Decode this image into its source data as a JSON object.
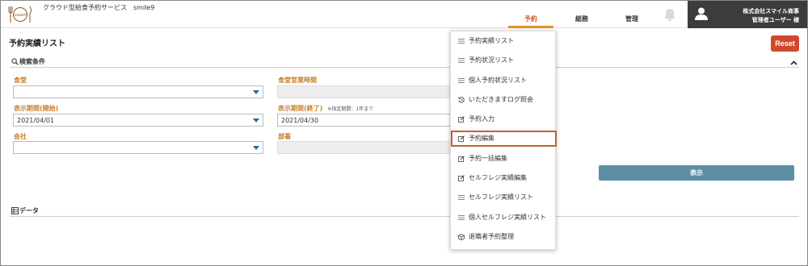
{
  "app": {
    "title": "クラウド型給食予約サービス　smile9",
    "logo_text": "Smile9"
  },
  "nav": {
    "tabs": [
      {
        "label": "予約"
      },
      {
        "label": "総務"
      },
      {
        "label": "管理"
      }
    ]
  },
  "user": {
    "company": "株式会社スマイル商事",
    "name": "管理者ユーザー 様"
  },
  "page": {
    "title": "予約実績リスト",
    "reset_label": "Reset",
    "search_section": "検索条件",
    "data_section": "データ",
    "show_label": "表示"
  },
  "form": {
    "cafeteria_label": "食堂",
    "cafeteria_value": "",
    "hours_label": "食堂営業時間",
    "start_label": "表示期間(開始)",
    "start_value": "2021/04/01",
    "end_label": "表示期間(終了)",
    "end_note": "※指定期間：1年まで",
    "end_value": "2021/04/30",
    "company_label": "会社",
    "company_value": "",
    "dept_label": "部署"
  },
  "menu": {
    "items": [
      {
        "label": "予約実績リスト",
        "icon": "list-icon"
      },
      {
        "label": "予約状況リスト",
        "icon": "list-icon"
      },
      {
        "label": "個人予約状況リスト",
        "icon": "list-icon"
      },
      {
        "label": "いただきますログ照会",
        "icon": "history-icon"
      },
      {
        "label": "予約入力",
        "icon": "edit-icon"
      },
      {
        "label": "予約編集",
        "icon": "edit-icon"
      },
      {
        "label": "予約一括編集",
        "icon": "edit-icon"
      },
      {
        "label": "セルフレジ実績編集",
        "icon": "edit-icon"
      },
      {
        "label": "セルフレジ実績リスト",
        "icon": "list-icon"
      },
      {
        "label": "個人セルフレジ実績リスト",
        "icon": "list-icon"
      },
      {
        "label": "退職者予約整理",
        "icon": "box-icon"
      }
    ]
  },
  "colors": {
    "accent": "#c8602a",
    "label": "#c8802a",
    "reset": "#d0492f",
    "show": "#5d8ea3",
    "user_bg": "#3c3c3c"
  }
}
